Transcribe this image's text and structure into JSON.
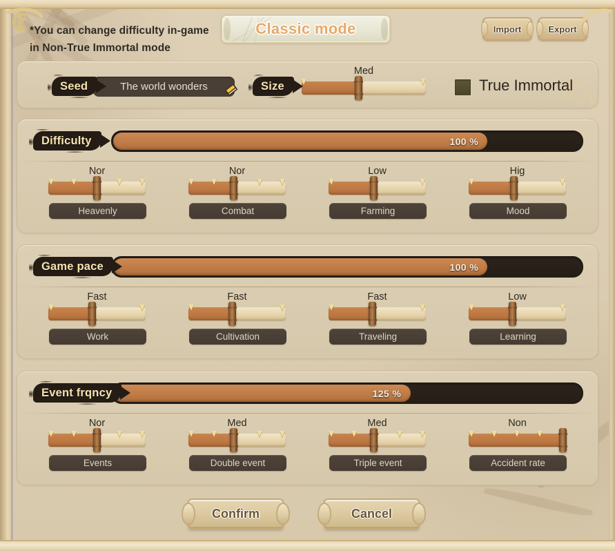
{
  "header": {
    "hint_line1": "*You can change difficulty in-game",
    "hint_line2": "in Non-True Immortal mode",
    "mode_title": "Classic mode",
    "import_label": "Import",
    "export_label": "Export"
  },
  "world": {
    "seed_label": "Seed",
    "seed_value": "The world wonders",
    "edit_icon": "pencil-icon",
    "size_label": "Size",
    "size_slider": {
      "caption": "Med",
      "value": 46,
      "ticks": [
        0,
        100
      ]
    },
    "true_immortal_label": "True Immortal",
    "true_immortal_checked": false
  },
  "sections": [
    {
      "key": "difficulty",
      "label": "Difficulty",
      "percent_text": "100 %",
      "percent_value": 100,
      "bar_fill_ratio": 0.8,
      "sliders": [
        {
          "caption": "Nor",
          "value": 50,
          "ticks": [
            0,
            25,
            50,
            75,
            100
          ],
          "name": "Heavenly"
        },
        {
          "caption": "Nor",
          "value": 46,
          "ticks": [
            0,
            25,
            50,
            75,
            100
          ],
          "name": "Combat"
        },
        {
          "caption": "Low",
          "value": 46,
          "ticks": [
            0,
            100
          ],
          "name": "Farming"
        },
        {
          "caption": "Hig",
          "value": 46,
          "ticks": [
            0,
            100
          ],
          "name": "Mood"
        }
      ]
    },
    {
      "key": "gamepace",
      "label": "Game pace",
      "percent_text": "100 %",
      "percent_value": 100,
      "bar_fill_ratio": 0.8,
      "sliders": [
        {
          "caption": "Fast",
          "value": 45,
          "ticks": [
            0,
            100
          ],
          "name": "Work"
        },
        {
          "caption": "Fast",
          "value": 45,
          "ticks": [
            0,
            100
          ],
          "name": "Cultivation"
        },
        {
          "caption": "Fast",
          "value": 45,
          "ticks": [
            0,
            100
          ],
          "name": "Traveling"
        },
        {
          "caption": "Low",
          "value": 45,
          "ticks": [
            0,
            100
          ],
          "name": "Learning"
        }
      ]
    },
    {
      "key": "event",
      "label": "Event frqncy",
      "percent_text": "125 %",
      "percent_value": 125,
      "bar_fill_ratio": 0.635,
      "sliders": [
        {
          "caption": "Nor",
          "value": 50,
          "ticks": [
            0,
            25,
            50,
            75,
            100
          ],
          "name": "Events"
        },
        {
          "caption": "Med",
          "value": 46,
          "ticks": [
            0,
            25,
            50,
            75,
            100
          ],
          "name": "Double event"
        },
        {
          "caption": "Med",
          "value": 46,
          "ticks": [
            0,
            25,
            50,
            75,
            100
          ],
          "name": "Triple event"
        },
        {
          "caption": "Non",
          "value": 100,
          "ticks": [
            0,
            25,
            50,
            75,
            100
          ],
          "name": "Accident rate"
        }
      ]
    }
  ],
  "footer": {
    "confirm_label": "Confirm",
    "cancel_label": "Cancel"
  },
  "colors": {
    "accent_orange": "#c07c46",
    "panel_bg": "#d9cbb0",
    "ink_dark": "#241c15",
    "chip_dark": "#4a3f36",
    "title_text": "#e8a96a"
  }
}
